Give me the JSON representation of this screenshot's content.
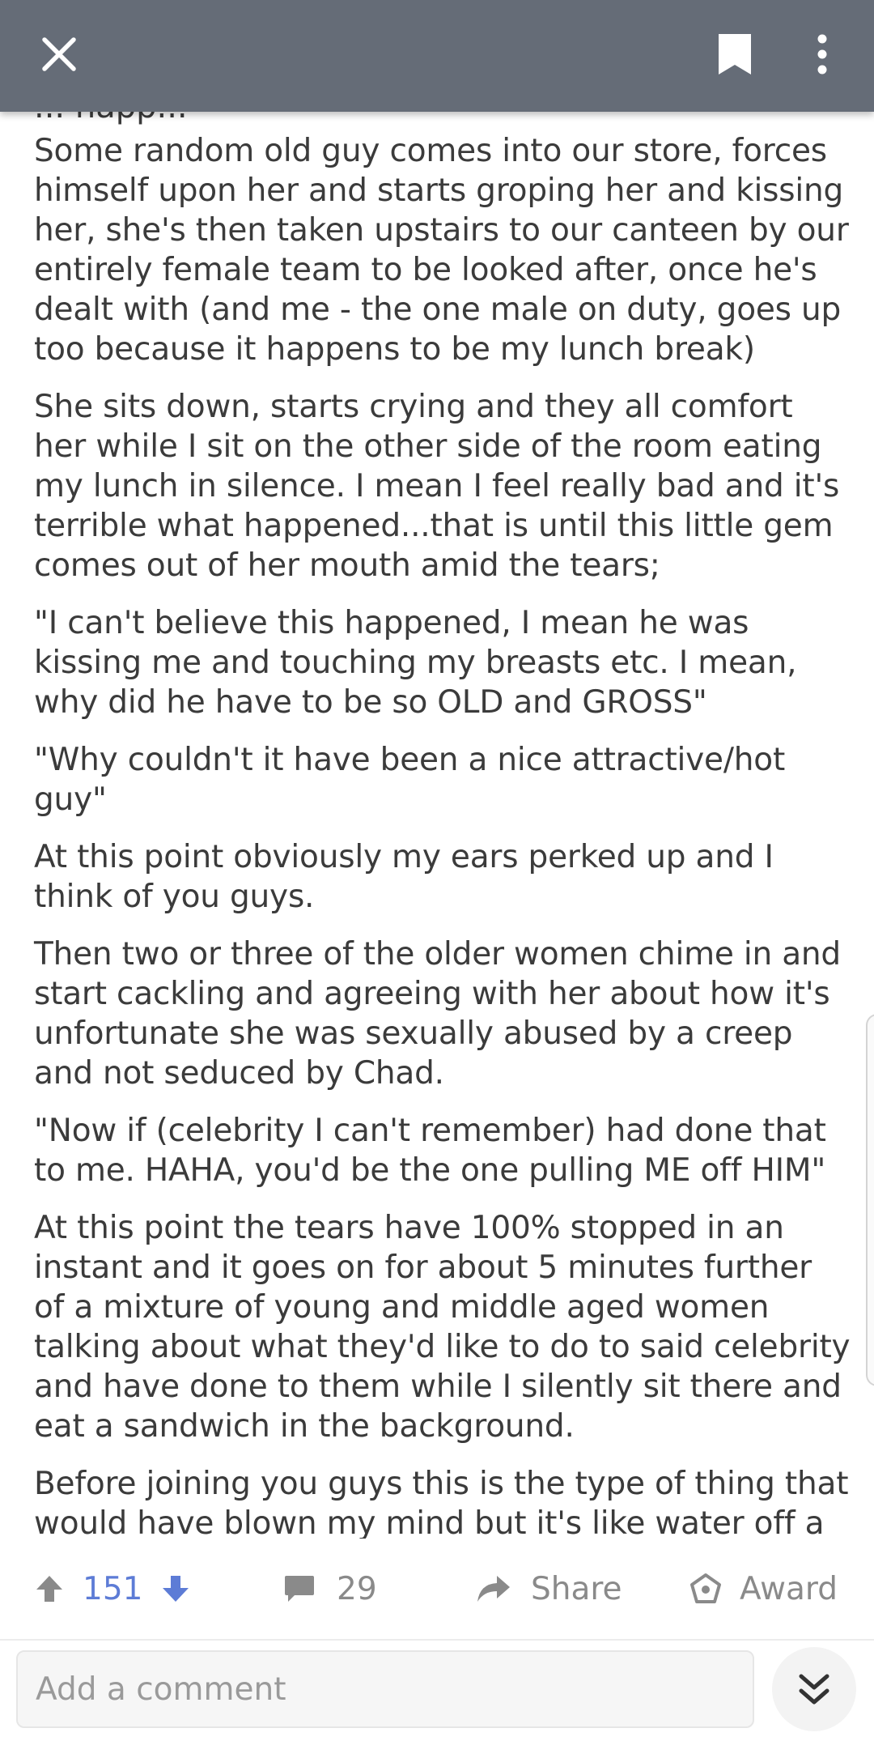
{
  "top_bar": {
    "close_icon": "close-icon",
    "bookmark_icon": "bookmark-icon",
    "more_icon": "more-vertical-icon",
    "background": "#656c77"
  },
  "post": {
    "partial_top_line": "... happ...",
    "paragraphs": [
      "Some random old guy comes into our store, forces himself upon her and starts groping her and kissing her, she's then taken upstairs to our canteen by our entirely female team to be looked after, once he's dealt with (and me - the one male on duty, goes up too because it happens to be my lunch break)",
      "She sits down, starts crying and they all comfort her while I sit on the other side of the room eating my lunch in silence. I mean I feel really bad and it's terrible what happened...that is until this little gem comes out of her mouth amid the tears;",
      "\"I can't believe this happened, I mean he was kissing me and touching my breasts etc. I mean, why did he have to be so OLD and GROSS\"",
      "\"Why couldn't it have been a nice attractive/hot guy\"",
      "At this point obviously my ears perked up and I think of you guys.",
      "Then two or three of the older women chime in and start cackling and agreeing with her about how it's unfortunate she was sexually abused by a creep and not seduced by Chad.",
      "\"Now if (celebrity I can't remember) had done that to me. HAHA, you'd be the one pulling ME off HIM\"",
      "At this point the tears have 100% stopped in an instant and it goes on for about 5 minutes further of a mixture of young and middle aged women talking about what they'd like to do to said celebrity and have done to them while I silently sit there and eat a sandwich in the background.",
      "Before joining you guys this is the type of thing that would have blown my mind but it's like water off a ducks back now. It's all an act, crocodile tears"
    ]
  },
  "actions": {
    "vote_count": "151",
    "comment_count": "29",
    "share_label": "Share",
    "award_label": "Award",
    "vote_color": "#5d7cd6"
  },
  "composer": {
    "placeholder": "Add a comment",
    "expand_icon": "double-chevron-down-icon"
  }
}
